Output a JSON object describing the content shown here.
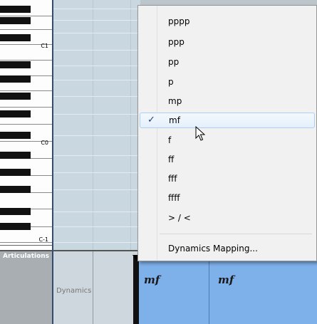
{
  "keyboard": {
    "octave_labels": [
      "C1",
      "C0",
      "C-1"
    ]
  },
  "lane": {
    "header_label": "Articulations",
    "name": "Dynamics"
  },
  "dynamics_lane": {
    "events": [
      "mf",
      "mf"
    ]
  },
  "context_menu": {
    "items": [
      {
        "label": "pppp",
        "checked": false
      },
      {
        "label": "ppp",
        "checked": false
      },
      {
        "label": "pp",
        "checked": false
      },
      {
        "label": "p",
        "checked": false
      },
      {
        "label": "mp",
        "checked": false
      },
      {
        "label": "mf",
        "checked": true
      },
      {
        "label": "f",
        "checked": false
      },
      {
        "label": "ff",
        "checked": false
      },
      {
        "label": "fff",
        "checked": false
      },
      {
        "label": "ffff",
        "checked": false
      },
      {
        "label": "> / <",
        "checked": false
      }
    ],
    "footer_item": "Dynamics Mapping...",
    "checkmark": "✓"
  },
  "colors": {
    "selection_border": "#aecff4",
    "lane_blue": "#7eb0ea",
    "keyboard_divider": "#314b72"
  }
}
